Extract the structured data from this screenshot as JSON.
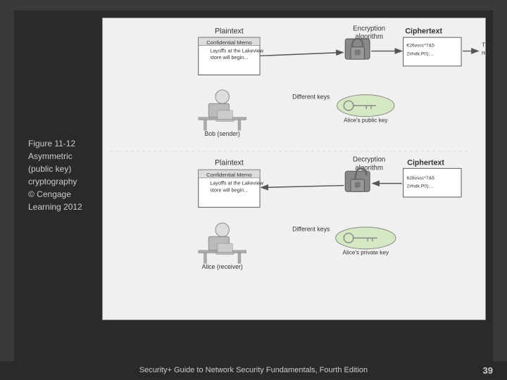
{
  "caption": {
    "line1": "Figure 11-12",
    "line2": "Asymmetric",
    "line3": "(public key)",
    "line4": "cryptography",
    "line5": "© Cengage",
    "line6": "Learning 2012"
  },
  "bottom": {
    "text": "Security+ Guide to Network Security Fundamentals, Fourth Edition",
    "page": "39"
  },
  "diagram": {
    "plaintext_label": "Plaintext",
    "encryption_label": "Encryption algorithm",
    "ciphertext_top_label": "Ciphertext",
    "ciphertext_top_value": "€26vscc*7&5\n2#hdk.P0);...",
    "bob_label": "Bob (sender)",
    "different_keys_top": "Different keys",
    "alice_public_key": "Alice's public key",
    "transmitted_label": "Transmitted to remote user",
    "plaintext_bottom_label": "Plaintext",
    "decryption_label": "Decryption algorithm",
    "ciphertext_bottom_label": "Ciphertext",
    "ciphertext_bottom_value": "626vscc*7&5\n2#hdk.P0);...",
    "alice_label": "Alice (receiver)",
    "different_keys_bottom": "Different keys",
    "alice_private_key": "Alice's private key",
    "memo_text_top": "Confidential Memo\nLayoffs at the Lakeview\nstore will begin...",
    "memo_text_bottom": "Confidential Memo\nLayoffs at the Lakeview\nstore will begin..."
  }
}
